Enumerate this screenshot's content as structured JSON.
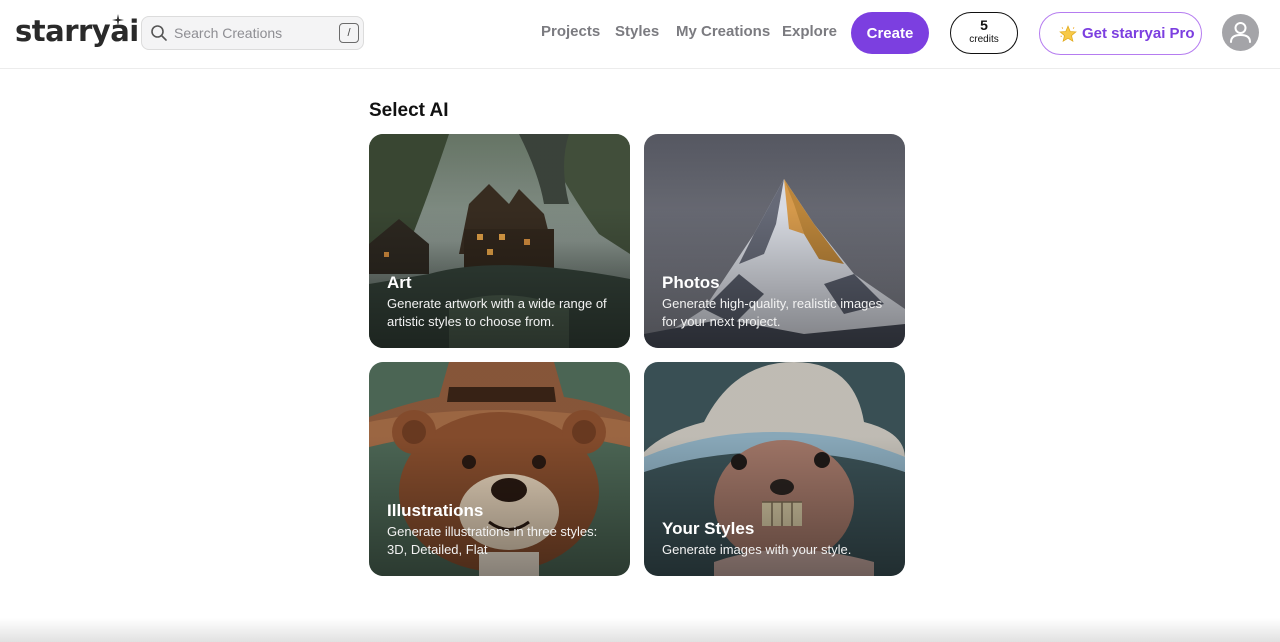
{
  "header": {
    "logo_text": "starryai",
    "search": {
      "placeholder": "Search Creations",
      "shortcut": "/"
    },
    "nav": [
      "Projects",
      "Styles",
      "My Creations",
      "Explore"
    ],
    "create_label": "Create",
    "credits": {
      "count": "5",
      "label": "credits"
    },
    "pro_label": "Get starryai Pro"
  },
  "main": {
    "title": "Select AI",
    "cards": [
      {
        "title": "Art",
        "description": "Generate artwork with a wide range of artistic styles to choose from."
      },
      {
        "title": "Photos",
        "description": "Generate high-quality, realistic images for your next project."
      },
      {
        "title": "Illustrations",
        "description": "Generate illustrations in three styles: 3D, Detailed, Flat"
      },
      {
        "title": "Your Styles",
        "description": "Generate images with your style."
      }
    ]
  },
  "colors": {
    "accent": "#7c3fe0",
    "accent_border": "#b57cf0",
    "nav_text": "#7b7b80"
  },
  "icons": [
    "search-icon",
    "sparkle-icon",
    "star-icon",
    "user-icon"
  ]
}
